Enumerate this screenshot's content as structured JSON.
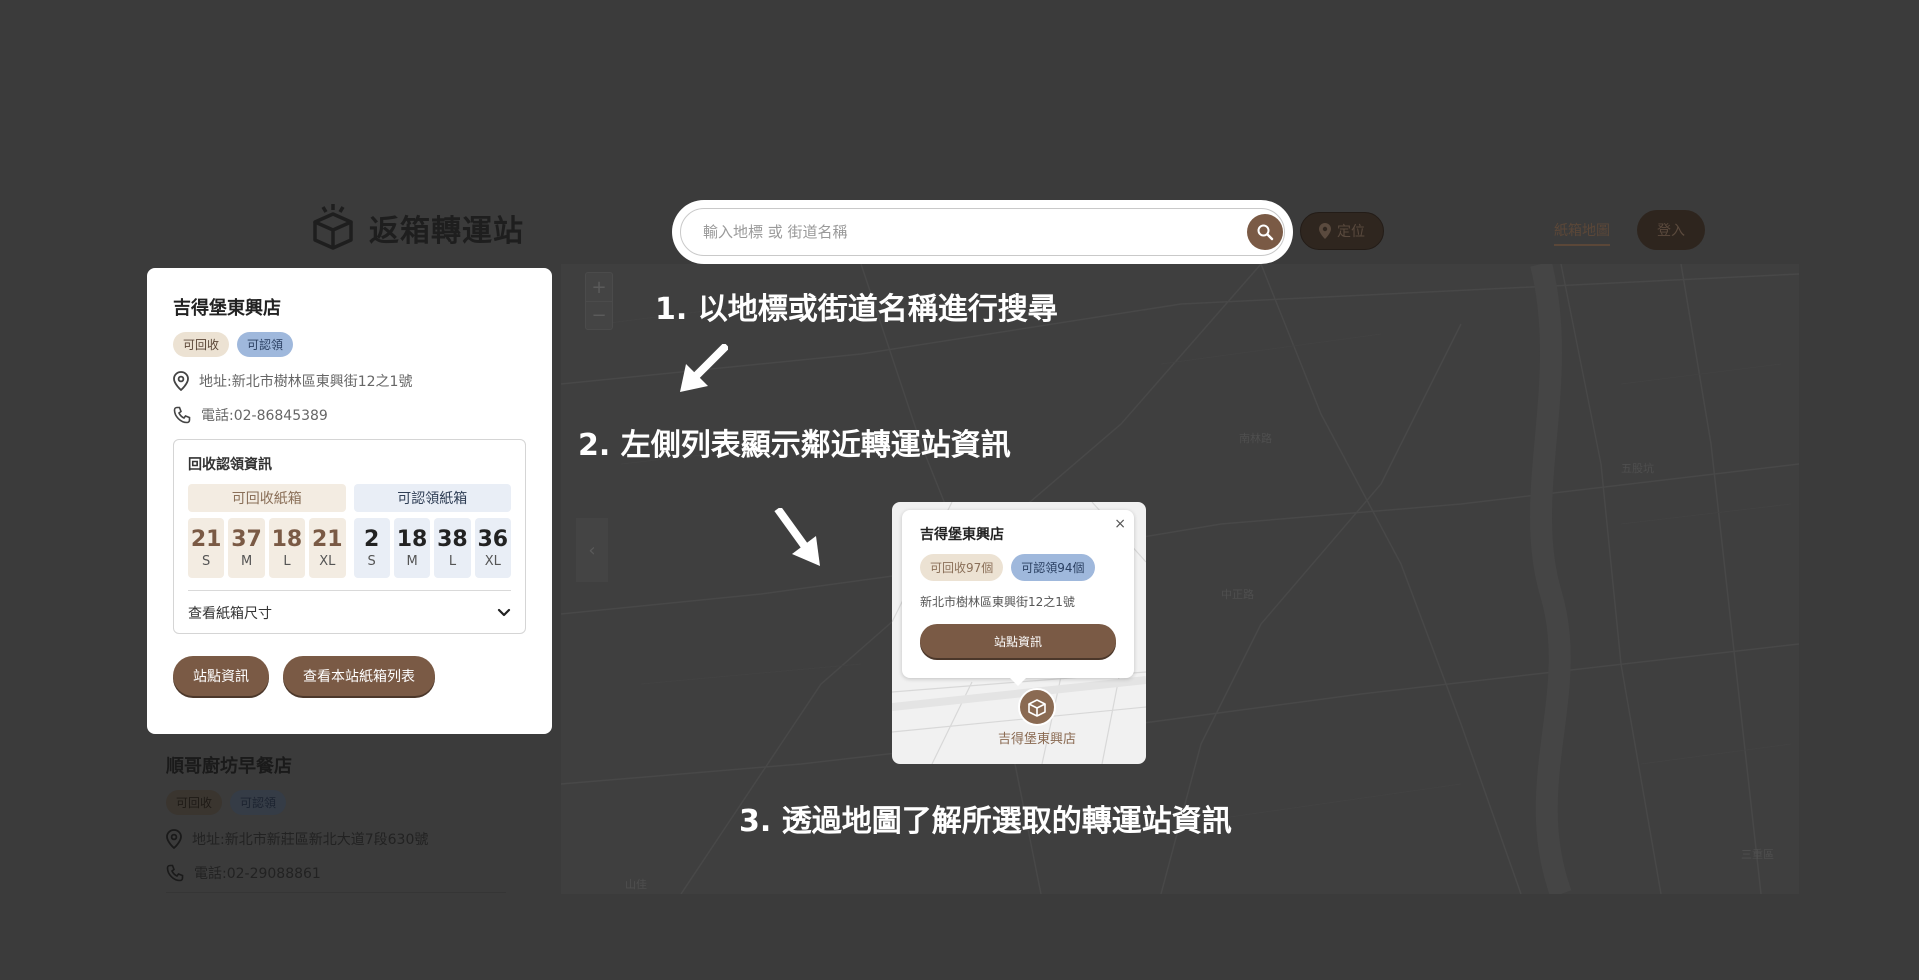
{
  "header": {
    "logo_text": "返箱轉運站",
    "search_placeholder": "輸入地標 或 街道名稱",
    "locate_label": "定位",
    "nav_map": "紙箱地圖",
    "login_label": "登入"
  },
  "map": {
    "zoom_in": "+",
    "zoom_out": "−",
    "collapse": "‹",
    "labels": [
      "南林路",
      "中正路",
      "五股坑",
      "三重區",
      "山佳"
    ]
  },
  "stations": [
    {
      "name": "吉得堡東興店",
      "tag_recycle": "可回收",
      "tag_claim": "可認領",
      "address": "地址:新北市樹林區東興街12之1號",
      "phone": "電話:02-86845389",
      "panel_title": "回收認領資訊",
      "recycle_head": "可回收紙箱",
      "claim_head": "可認領紙箱",
      "recycle_sizes": [
        {
          "count": "21",
          "label": "S"
        },
        {
          "count": "37",
          "label": "M"
        },
        {
          "count": "18",
          "label": "L"
        },
        {
          "count": "21",
          "label": "XL"
        }
      ],
      "claim_sizes": [
        {
          "count": "2",
          "label": "S"
        },
        {
          "count": "18",
          "label": "M"
        },
        {
          "count": "38",
          "label": "L"
        },
        {
          "count": "36",
          "label": "XL"
        }
      ],
      "toggle_label": "查看紙箱尺寸",
      "btn_info": "站點資訊",
      "btn_list": "查看本站紙箱列表"
    },
    {
      "name": "順哥廚坊早餐店",
      "tag_recycle": "可回收",
      "tag_claim": "可認領",
      "address": "地址:新北市新莊區新北大道7段630號",
      "phone": "電話:02-29088861"
    }
  ],
  "popup": {
    "name": "吉得堡東興店",
    "recycle": "可回收97個",
    "claim": "可認領94個",
    "address": "新北市樹林區東興街12之1號",
    "button": "站點資訊",
    "close": "×",
    "marker_label": "吉得堡東興店"
  },
  "steps": {
    "step1": "1. 以地標或街道名稱進行搜尋",
    "step2": "2. 左側列表顯示鄰近轉運站資訊",
    "step3": "3. 透過地圖了解所選取的轉運站資訊"
  },
  "colors": {
    "overlay": "#3b3b3b",
    "brand_brown": "#7a5a45",
    "claim_blue": "#9fb8dc",
    "recycle_beige": "#ece2d3"
  }
}
